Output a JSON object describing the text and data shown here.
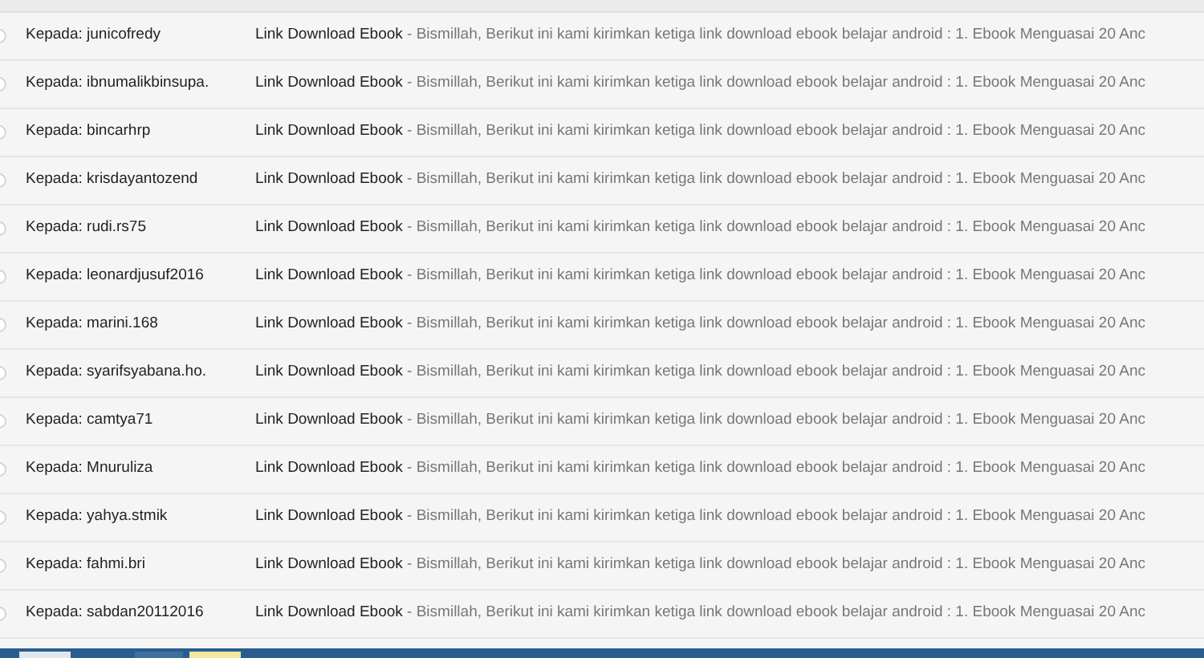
{
  "messages": [
    {
      "recipient": "Kepada: junicofredy",
      "subject": "Link Download Ebook",
      "snippet": "- Bismillah, Berikut ini kami kirimkan ketiga link download ebook belajar android : 1. Ebook Menguasai 20 Anc"
    },
    {
      "recipient": "Kepada: ibnumalikbinsupa.",
      "subject": "Link Download Ebook",
      "snippet": "- Bismillah, Berikut ini kami kirimkan ketiga link download ebook belajar android : 1. Ebook Menguasai 20 Anc"
    },
    {
      "recipient": "Kepada: bincarhrp",
      "subject": "Link Download Ebook",
      "snippet": "- Bismillah, Berikut ini kami kirimkan ketiga link download ebook belajar android : 1. Ebook Menguasai 20 Anc"
    },
    {
      "recipient": "Kepada: krisdayantozend",
      "subject": "Link Download Ebook",
      "snippet": "- Bismillah, Berikut ini kami kirimkan ketiga link download ebook belajar android : 1. Ebook Menguasai 20 Anc"
    },
    {
      "recipient": "Kepada: rudi.rs75",
      "subject": "Link Download Ebook",
      "snippet": "- Bismillah, Berikut ini kami kirimkan ketiga link download ebook belajar android : 1. Ebook Menguasai 20 Anc"
    },
    {
      "recipient": "Kepada: leonardjusuf2016",
      "subject": "Link Download Ebook",
      "snippet": "- Bismillah, Berikut ini kami kirimkan ketiga link download ebook belajar android : 1. Ebook Menguasai 20 Anc"
    },
    {
      "recipient": "Kepada: marini.168",
      "subject": "Link Download Ebook",
      "snippet": "- Bismillah, Berikut ini kami kirimkan ketiga link download ebook belajar android : 1. Ebook Menguasai 20 Anc"
    },
    {
      "recipient": "Kepada: syarifsyabana.ho.",
      "subject": "Link Download Ebook",
      "snippet": "- Bismillah, Berikut ini kami kirimkan ketiga link download ebook belajar android : 1. Ebook Menguasai 20 Anc"
    },
    {
      "recipient": "Kepada: camtya71",
      "subject": "Link Download Ebook",
      "snippet": "- Bismillah, Berikut ini kami kirimkan ketiga link download ebook belajar android : 1. Ebook Menguasai 20 Anc"
    },
    {
      "recipient": "Kepada: Mnuruliza",
      "subject": "Link Download Ebook",
      "snippet": "- Bismillah, Berikut ini kami kirimkan ketiga link download ebook belajar android : 1. Ebook Menguasai 20 Anc"
    },
    {
      "recipient": "Kepada: yahya.stmik",
      "subject": "Link Download Ebook",
      "snippet": "- Bismillah, Berikut ini kami kirimkan ketiga link download ebook belajar android : 1. Ebook Menguasai 20 Anc"
    },
    {
      "recipient": "Kepada: fahmi.bri",
      "subject": "Link Download Ebook",
      "snippet": "- Bismillah, Berikut ini kami kirimkan ketiga link download ebook belajar android : 1. Ebook Menguasai 20 Anc"
    },
    {
      "recipient": "Kepada: sabdan20112016",
      "subject": "Link Download Ebook",
      "snippet": "- Bismillah, Berikut ini kami kirimkan ketiga link download ebook belajar android : 1. Ebook Menguasai 20 Anc"
    }
  ]
}
